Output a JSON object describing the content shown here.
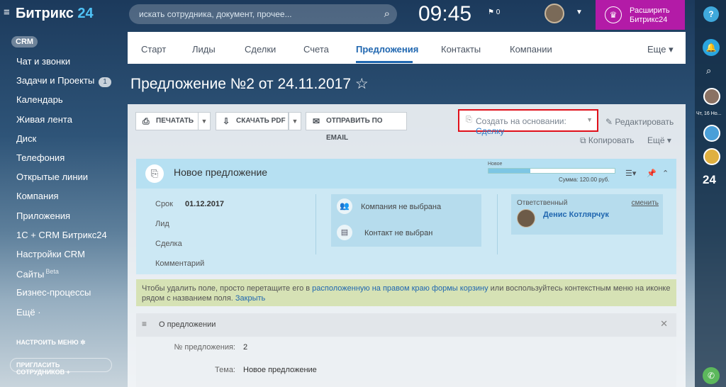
{
  "topbar": {
    "logo_main": "Битрикс",
    "logo_num": "24",
    "search_placeholder": "искать сотрудника, документ, прочее...",
    "clock": "09:45",
    "flag_count": "0",
    "upgrade_line1": "Расширить",
    "upgrade_line2": "Битрикс24"
  },
  "sidebar": {
    "badge": "CRM",
    "items": [
      {
        "label": "Чат и звонки"
      },
      {
        "label": "Задачи и Проекты",
        "count": "1"
      },
      {
        "label": "Календарь"
      },
      {
        "label": "Живая лента"
      },
      {
        "label": "Диск"
      },
      {
        "label": "Телефония"
      },
      {
        "label": "Открытые линии"
      },
      {
        "label": "Компания"
      },
      {
        "label": "Приложения"
      },
      {
        "label": "1С + CRM Битрикс24"
      },
      {
        "label": "Настройки CRM"
      },
      {
        "label": "Сайты",
        "sup": "Beta"
      },
      {
        "label": "Бизнес-процессы"
      },
      {
        "label": "Ещё ·"
      }
    ],
    "setup": "НАСТРОИТЬ МЕНЮ",
    "invite": "ПРИГЛАСИТЬ СОТРУДНИКОВ +"
  },
  "rightbar": {
    "help": "?",
    "date": "Чт, 16 Но...",
    "b24": "24"
  },
  "tabs": [
    "Старт",
    "Лиды",
    "Сделки",
    "Счета",
    "Предложения",
    "Контакты",
    "Компании",
    "Еще ▾"
  ],
  "page": {
    "title": "Предложение №2 от 24.11.2017 ☆"
  },
  "toolbar": {
    "print": "ПЕЧАТАТЬ",
    "pdf": "СКАЧАТЬ PDF",
    "email": "ОТПРАВИТЬ ПО EMAIL",
    "create_based": "Создать на основании:",
    "create_based_value": "Сделку",
    "edit": "Редактировать",
    "copy": "Копировать",
    "more": "Ещё ▾"
  },
  "card": {
    "title": "Новое предложение",
    "stage": "Новое",
    "stage_progress": 0.33,
    "sum": "Сумма: 120.00 руб.",
    "fields": [
      {
        "label": "Срок",
        "value": "01.12.2017"
      },
      {
        "label": "Лид",
        "value": ""
      },
      {
        "label": "Сделка",
        "value": ""
      },
      {
        "label": "Комментарий",
        "value": ""
      }
    ],
    "company": "Компания не выбрана",
    "contact": "Контакт не выбран",
    "responsible_label": "Ответственный",
    "change": "сменить",
    "responsible_name": "Денис Котлярчук"
  },
  "hint": {
    "before": "Чтобы удалить поле, просто перетащите его в ",
    "link": "расположенную на правом краю формы корзину",
    "after": " или воспользуйтесь контекстным меню на иконке рядом с названием поля. ",
    "close": "Закрыть"
  },
  "section": {
    "title": "О предложении",
    "rows": [
      {
        "label": "№ предложения:",
        "value": "2"
      },
      {
        "label": "Тема:",
        "value": "Новое предложение"
      }
    ]
  }
}
